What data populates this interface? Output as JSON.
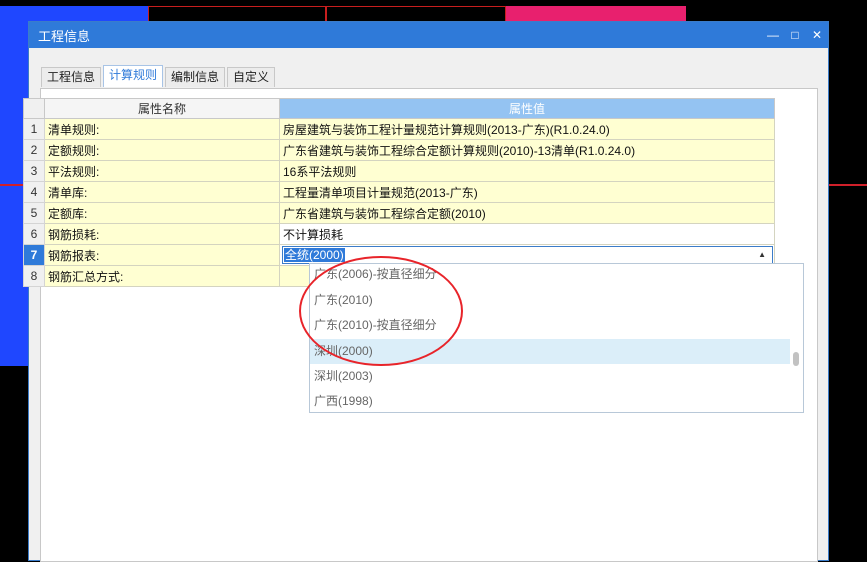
{
  "window": {
    "title": "工程信息",
    "min_glyph": "—",
    "max_glyph": "□",
    "close_glyph": "✕"
  },
  "tabs": [
    {
      "label": "工程信息"
    },
    {
      "label": "计算规则"
    },
    {
      "label": "编制信息"
    },
    {
      "label": "自定义"
    }
  ],
  "table": {
    "col_name": "属性名称",
    "col_value": "属性值",
    "rows": [
      {
        "idx": "1",
        "name": "清单规则:",
        "value": "房屋建筑与装饰工程计量规范计算规则(2013-广东)(R1.0.24.0)"
      },
      {
        "idx": "2",
        "name": "定额规则:",
        "value": "广东省建筑与装饰工程综合定额计算规则(2010)-13清单(R1.0.24.0)"
      },
      {
        "idx": "3",
        "name": "平法规则:",
        "value": "16系平法规则"
      },
      {
        "idx": "4",
        "name": "清单库:",
        "value": "工程量清单项目计量规范(2013-广东)"
      },
      {
        "idx": "5",
        "name": "定额库:",
        "value": "广东省建筑与装饰工程综合定额(2010)"
      },
      {
        "idx": "6",
        "name": "钢筋损耗:",
        "value": "不计算损耗"
      },
      {
        "idx": "7",
        "name": "钢筋报表:",
        "value": "全统(2000)"
      },
      {
        "idx": "8",
        "name": "钢筋汇总方式:",
        "value": ""
      }
    ]
  },
  "dropdown": {
    "arrow_glyph": "▲",
    "options": [
      {
        "label": "广东(2006)-按直径细分"
      },
      {
        "label": "广东(2010)"
      },
      {
        "label": "广东(2010)-按直径细分"
      },
      {
        "label": "深圳(2000)"
      },
      {
        "label": "深圳(2003)"
      },
      {
        "label": "广西(1998)"
      }
    ]
  },
  "colors": {
    "accent": "#2f7ad9",
    "header_value_bg": "#94c3f2",
    "cell_yellow": "#ffffd2",
    "annotation": "#e8242a"
  }
}
